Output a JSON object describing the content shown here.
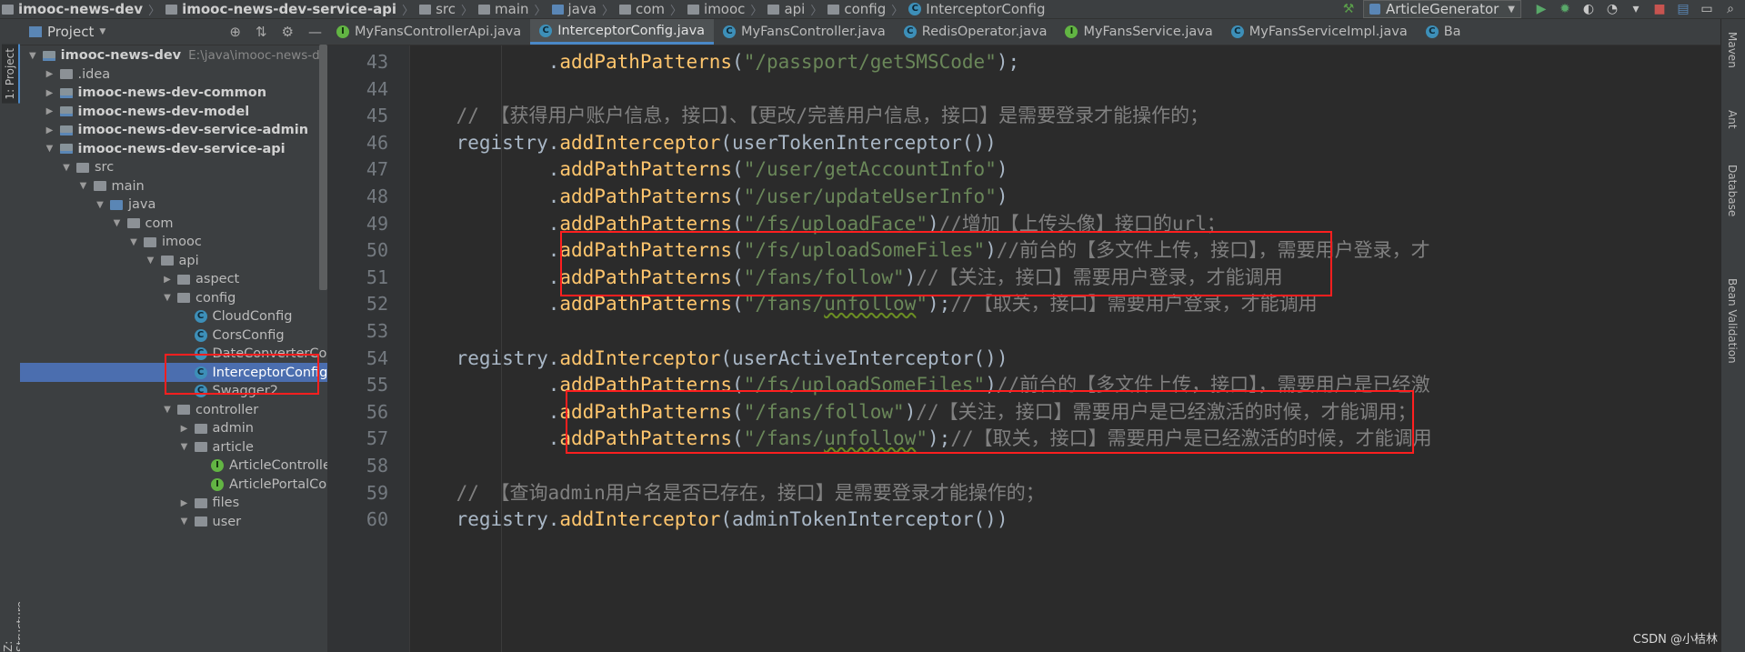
{
  "navbar": {
    "crumbs": [
      "imooc-news-dev",
      "imooc-news-dev-service-api",
      "src",
      "main",
      "java",
      "com",
      "imooc",
      "api",
      "config",
      "InterceptorConfig"
    ],
    "run_config": "ArticleGenerator"
  },
  "left_stripe": {
    "project_tab": "1: Project",
    "structure_tab": "Z: Structure"
  },
  "project_panel": {
    "title": "Project",
    "tree": [
      {
        "label": "imooc-news-dev",
        "path": "E:\\java\\imooc-news-dev",
        "depth": 0,
        "expanded": true,
        "type": "module"
      },
      {
        "label": ".idea",
        "depth": 1,
        "expanded": false,
        "type": "folder"
      },
      {
        "label": "imooc-news-dev-common",
        "depth": 1,
        "expanded": false,
        "type": "module"
      },
      {
        "label": "imooc-news-dev-model",
        "depth": 1,
        "expanded": false,
        "type": "module"
      },
      {
        "label": "imooc-news-dev-service-admin",
        "depth": 1,
        "expanded": false,
        "type": "module"
      },
      {
        "label": "imooc-news-dev-service-api",
        "depth": 1,
        "expanded": true,
        "type": "module"
      },
      {
        "label": "src",
        "depth": 2,
        "expanded": true,
        "type": "folder"
      },
      {
        "label": "main",
        "depth": 3,
        "expanded": true,
        "type": "folder"
      },
      {
        "label": "java",
        "depth": 4,
        "expanded": true,
        "type": "source"
      },
      {
        "label": "com",
        "depth": 5,
        "expanded": true,
        "type": "package"
      },
      {
        "label": "imooc",
        "depth": 6,
        "expanded": true,
        "type": "package"
      },
      {
        "label": "api",
        "depth": 7,
        "expanded": true,
        "type": "package"
      },
      {
        "label": "aspect",
        "depth": 8,
        "expanded": false,
        "type": "package"
      },
      {
        "label": "config",
        "depth": 8,
        "expanded": true,
        "type": "package"
      },
      {
        "label": "CloudConfig",
        "depth": 9,
        "type": "class"
      },
      {
        "label": "CorsConfig",
        "depth": 9,
        "type": "class"
      },
      {
        "label": "DateConverterConfig",
        "depth": 9,
        "type": "class"
      },
      {
        "label": "InterceptorConfig",
        "depth": 9,
        "type": "class",
        "selected": true
      },
      {
        "label": "Swagger2",
        "depth": 9,
        "type": "class"
      },
      {
        "label": "controller",
        "depth": 8,
        "expanded": true,
        "type": "package"
      },
      {
        "label": "admin",
        "depth": 9,
        "expanded": false,
        "type": "package"
      },
      {
        "label": "article",
        "depth": 9,
        "expanded": true,
        "type": "package"
      },
      {
        "label": "ArticleControllerAp",
        "depth": 10,
        "type": "interface"
      },
      {
        "label": "ArticlePortalContro",
        "depth": 10,
        "type": "interface"
      },
      {
        "label": "files",
        "depth": 9,
        "expanded": false,
        "type": "package"
      },
      {
        "label": "user",
        "depth": 9,
        "expanded": true,
        "type": "package"
      }
    ]
  },
  "editor": {
    "tabs": [
      {
        "label": "MyFansControllerApi.java",
        "kind": "interface"
      },
      {
        "label": "InterceptorConfig.java",
        "kind": "class",
        "active": true
      },
      {
        "label": "MyFansController.java",
        "kind": "class"
      },
      {
        "label": "RedisOperator.java",
        "kind": "class"
      },
      {
        "label": "MyFansService.java",
        "kind": "interface"
      },
      {
        "label": "MyFansServiceImpl.java",
        "kind": "class"
      },
      {
        "label": "Ba",
        "kind": "class"
      }
    ],
    "tab_more": "≡",
    "lines": [
      {
        "n": "43",
        "segs": [
          [
            "t",
            "            "
          ],
          [
            "t",
            "."
          ],
          [
            "m",
            "addPathPatterns"
          ],
          [
            "t",
            "("
          ],
          [
            "s",
            "\"/passport/getSMSCode\""
          ],
          [
            "t",
            ");"
          ]
        ]
      },
      {
        "n": "44",
        "segs": []
      },
      {
        "n": "45",
        "segs": [
          [
            "t",
            "    "
          ],
          [
            "c",
            "// 【获得用户账户信息，接口】、【更改/完善用户信息，接口】是需要登录才能操作的；"
          ]
        ]
      },
      {
        "n": "46",
        "segs": [
          [
            "t",
            "    registry."
          ],
          [
            "m",
            "addInterceptor"
          ],
          [
            "t",
            "(userTokenInterceptor())"
          ]
        ]
      },
      {
        "n": "47",
        "segs": [
          [
            "t",
            "            ."
          ],
          [
            "m",
            "addPathPatterns"
          ],
          [
            "t",
            "("
          ],
          [
            "s",
            "\"/user/getAccountInfo\""
          ],
          [
            "t",
            ")"
          ]
        ]
      },
      {
        "n": "48",
        "segs": [
          [
            "t",
            "            ."
          ],
          [
            "m",
            "addPathPatterns"
          ],
          [
            "t",
            "("
          ],
          [
            "s",
            "\"/user/updateUserInfo\""
          ],
          [
            "t",
            ")"
          ]
        ]
      },
      {
        "n": "49",
        "segs": [
          [
            "t",
            "            ."
          ],
          [
            "m",
            "addPathPatterns"
          ],
          [
            "t",
            "("
          ],
          [
            "s",
            "\"/fs/uploadFace\""
          ],
          [
            "t",
            ")"
          ],
          [
            "c",
            "//增加【上传头像】接口的url；"
          ]
        ]
      },
      {
        "n": "50",
        "segs": [
          [
            "t",
            "            ."
          ],
          [
            "m",
            "addPathPatterns"
          ],
          [
            "t",
            "("
          ],
          [
            "s",
            "\"/fs/uploadSomeFiles\""
          ],
          [
            "t",
            ")"
          ],
          [
            "c",
            "//前台的【多文件上传，接口】，需要用户登录，才"
          ]
        ]
      },
      {
        "n": "51",
        "segs": [
          [
            "t",
            "            ."
          ],
          [
            "m",
            "addPathPatterns"
          ],
          [
            "t",
            "("
          ],
          [
            "s",
            "\"/fans/follow\""
          ],
          [
            "t",
            ")"
          ],
          [
            "c",
            "//【关注，接口】需要用户登录，才能调用"
          ]
        ]
      },
      {
        "n": "52",
        "segs": [
          [
            "t",
            "            ."
          ],
          [
            "m",
            "addPathPatterns"
          ],
          [
            "t",
            "("
          ],
          [
            "s",
            "\"/fans/"
          ],
          [
            "su",
            "unfollow"
          ],
          [
            "s",
            "\""
          ],
          [
            "t",
            ");"
          ],
          [
            "c",
            "//【取关，接口】需要用户登录，才能调用"
          ]
        ]
      },
      {
        "n": "53",
        "segs": []
      },
      {
        "n": "54",
        "segs": [
          [
            "t",
            "    registry."
          ],
          [
            "m",
            "addInterceptor"
          ],
          [
            "t",
            "(userActiveInterceptor())"
          ]
        ]
      },
      {
        "n": "55",
        "segs": [
          [
            "t",
            "            ."
          ],
          [
            "m",
            "addPathPatterns"
          ],
          [
            "t",
            "("
          ],
          [
            "s",
            "\"/fs/uploadSomeFiles\""
          ],
          [
            "t",
            ")"
          ],
          [
            "c",
            "//前台的【多文件上传，接口】，需要用户是已经激"
          ]
        ]
      },
      {
        "n": "56",
        "segs": [
          [
            "t",
            "            ."
          ],
          [
            "m",
            "addPathPatterns"
          ],
          [
            "t",
            "("
          ],
          [
            "s",
            "\"/fans/follow\""
          ],
          [
            "t",
            ")"
          ],
          [
            "c",
            "//【关注，接口】需要用户是已经激活的时候，才能调用；"
          ]
        ]
      },
      {
        "n": "57",
        "segs": [
          [
            "t",
            "            ."
          ],
          [
            "m",
            "addPathPatterns"
          ],
          [
            "t",
            "("
          ],
          [
            "s",
            "\"/fans/"
          ],
          [
            "su",
            "unfollow"
          ],
          [
            "s",
            "\""
          ],
          [
            "t",
            ");"
          ],
          [
            "c",
            "//【取关，接口】需要用户是已经激活的时候，才能调用"
          ]
        ]
      },
      {
        "n": "58",
        "segs": []
      },
      {
        "n": "59",
        "segs": [
          [
            "t",
            "    "
          ],
          [
            "c",
            "// 【查询admin用户名是否已存在，接口】是需要登录才能操作的；"
          ]
        ]
      },
      {
        "n": "60",
        "segs": [
          [
            "t",
            "    registry."
          ],
          [
            "m",
            "addInterceptor"
          ],
          [
            "t",
            "(adminTokenInterceptor())"
          ]
        ]
      }
    ]
  },
  "right_stripe": [
    "Maven",
    "Ant",
    "Database",
    "Bean Validation"
  ],
  "watermark": "CSDN @小桔林",
  "colors": {
    "keyword_method": "#ffc66d",
    "string": "#6a8759",
    "comment": "#808080",
    "selection": "#4b6eaf",
    "highlight_box": "#ff1f1f"
  }
}
